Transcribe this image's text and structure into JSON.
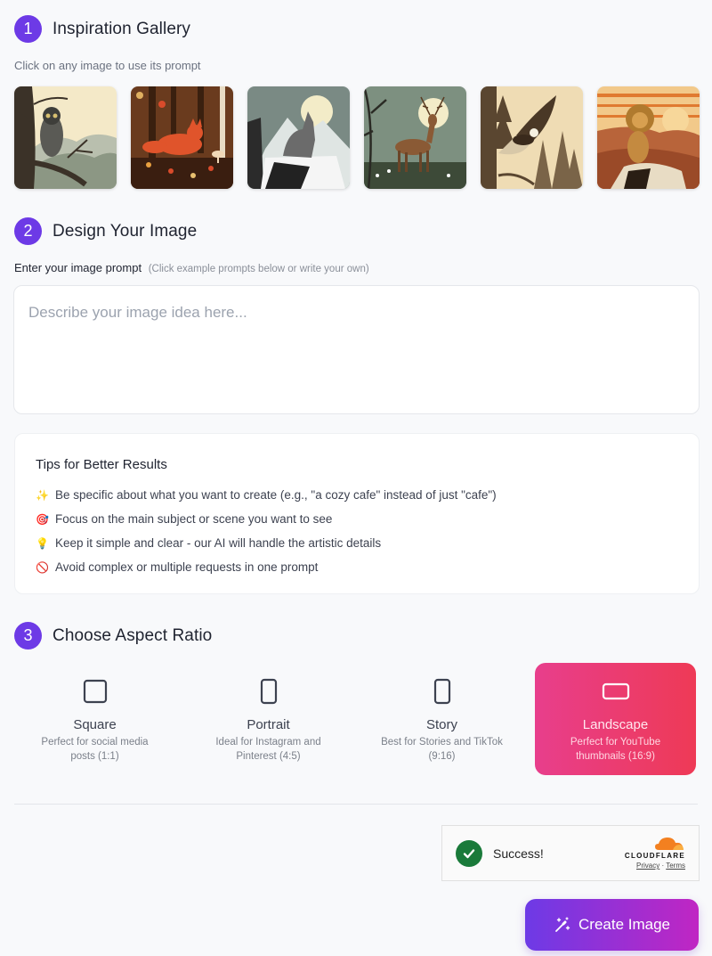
{
  "gallery": {
    "step_number": "1",
    "title": "Inspiration Gallery",
    "subtitle": "Click on any image to use its prompt",
    "images": [
      {
        "subject": "owl",
        "description": "Owl perched on tree branch with misty mountains"
      },
      {
        "subject": "fox",
        "description": "Red fox in autumn forest with mushrooms and leaves"
      },
      {
        "subject": "wolf",
        "description": "Wolf howling at full moon on snowy mountain"
      },
      {
        "subject": "deer",
        "description": "Deer stag under moon in grassy meadow"
      },
      {
        "subject": "eagle",
        "description": "Eagle flying over pine forest"
      },
      {
        "subject": "lion",
        "description": "Lion sitting on rock at sunset"
      }
    ]
  },
  "design": {
    "step_number": "2",
    "title": "Design Your Image",
    "prompt_label": "Enter your image prompt",
    "prompt_hint": "(Click example prompts below or write your own)",
    "prompt_value": "",
    "prompt_placeholder": "Describe your image idea here..."
  },
  "tips": {
    "title": "Tips for Better Results",
    "items": [
      {
        "icon": "✨",
        "icon_name": "sparkles-icon",
        "text": "Be specific about what you want to create (e.g., \"a cozy cafe\" instead of just \"cafe\")"
      },
      {
        "icon": "🎯",
        "icon_name": "target-icon",
        "text": "Focus on the main subject or scene you want to see"
      },
      {
        "icon": "💡",
        "icon_name": "lightbulb-icon",
        "text": "Keep it simple and clear - our AI will handle the artistic details"
      },
      {
        "icon": "🚫",
        "icon_name": "prohibited-icon",
        "text": "Avoid complex or multiple requests in one prompt"
      }
    ]
  },
  "aspect": {
    "step_number": "3",
    "title": "Choose Aspect Ratio",
    "selected": "Landscape",
    "options": [
      {
        "name": "Square",
        "description": "Perfect for social media posts (1:1)",
        "ratio": "1:1"
      },
      {
        "name": "Portrait",
        "description": "Ideal for Instagram and Pinterest (4:5)",
        "ratio": "4:5"
      },
      {
        "name": "Story",
        "description": "Best for Stories and TikTok (9:16)",
        "ratio": "9:16"
      },
      {
        "name": "Landscape",
        "description": "Perfect for YouTube thumbnails (16:9)",
        "ratio": "16:9"
      }
    ]
  },
  "captcha": {
    "status": "Success!",
    "brand": "CLOUDFLARE",
    "privacy_label": "Privacy",
    "separator": "·",
    "terms_label": "Terms"
  },
  "actions": {
    "create_label": "Create Image"
  },
  "colors": {
    "accent": "#6d3ae6",
    "selected_gradient_start": "#e83e8c",
    "selected_gradient_end": "#ee3a56",
    "button_gradient_start": "#6d3ae6",
    "button_gradient_end": "#c026c3",
    "success": "#1a7a3a",
    "cloudflare_orange": "#f38020"
  }
}
